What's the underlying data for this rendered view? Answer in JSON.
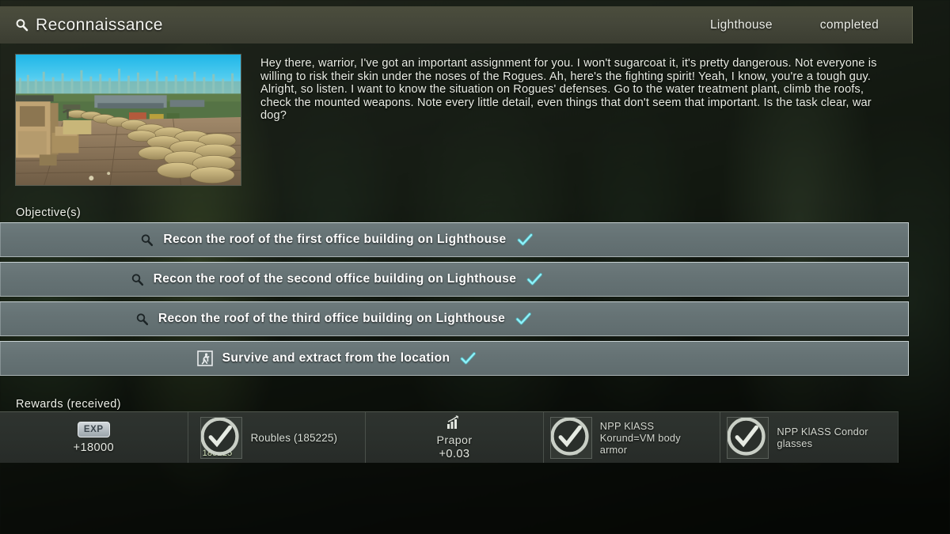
{
  "header": {
    "title": "Reconnaissance",
    "title_icon": "magnifier-icon",
    "location": "Lighthouse",
    "status": "completed"
  },
  "briefing": {
    "preview_alt": "rooftop-sandbag-position-preview",
    "text": "Hey there, warrior, I've got an important assignment for you. I won't sugarcoat it, it's pretty dangerous. Not everyone is willing to risk their skin under the noses of the Rogues. Ah, here's the fighting spirit! Yeah, I know, you're a tough guy. Alright, so listen. I want to know the situation on Rogues' defenses. Go to the water treatment plant, climb the roofs, check the mounted weapons. Note every little detail, even things that don't seem that important. Is the task clear, war dog?"
  },
  "objectives": {
    "label": "Objective(s)",
    "items": [
      {
        "icon": "magnifier-icon",
        "text": "Recon the roof of the first office building on Lighthouse",
        "completed": true
      },
      {
        "icon": "magnifier-icon",
        "text": "Recon the roof of the second office building on Lighthouse",
        "completed": true
      },
      {
        "icon": "magnifier-icon",
        "text": "Recon the roof of the third office building on Lighthouse",
        "completed": true
      },
      {
        "icon": "extract-runner-icon",
        "text": "Survive and extract from the location",
        "completed": true
      }
    ]
  },
  "rewards": {
    "label": "Rewards (received)",
    "exp": {
      "badge": "EXP",
      "value": "+18000"
    },
    "money": {
      "label": "Roubles (185225)",
      "stack_count": "185225",
      "icon": "rouble-banknotes-icon"
    },
    "reputation": {
      "icon": "reputation-chart-icon",
      "trader": "Prapor",
      "value": "+0.03"
    },
    "items": [
      {
        "icon": "body-armor-icon",
        "label": "NPP KlASS Korund=VM body armor"
      },
      {
        "icon": "glasses-icon",
        "label": "NPP KlASS Condor glasses"
      }
    ]
  },
  "colors": {
    "header_bg": "#45473a",
    "objective_row": "#667375",
    "check_accent": "#3fdbe8",
    "rewards_bg": "#2b302c",
    "text_primary": "#f2f3ee"
  }
}
